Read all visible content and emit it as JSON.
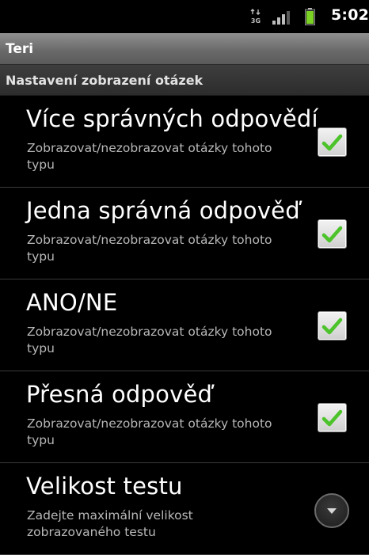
{
  "status_bar": {
    "network_type": "3G",
    "time": "5:02",
    "icons": [
      "data-3g-icon",
      "signal-strength-icon",
      "battery-icon"
    ]
  },
  "app_title": "Teri",
  "category": "Nastavení zobrazení otázek",
  "preferences": [
    {
      "title": "Více správných odpovědí",
      "summary": "Zobrazovat/nezobrazovat otázky tohoto typu",
      "checked": true
    },
    {
      "title": "Jedna správná odpověď",
      "summary": "Zobrazovat/nezobrazovat otázky tohoto typu",
      "checked": true
    },
    {
      "title": "ANO/NE",
      "summary": "Zobrazovat/nezobrazovat otázky tohoto typu",
      "checked": true
    },
    {
      "title": "Přesná odpověď",
      "summary": "Zobrazovat/nezobrazovat otázky tohoto typu",
      "checked": true
    },
    {
      "title": "Velikost testu",
      "summary": "Zadejte maximální velikost zobrazovaného testu",
      "control": "dropdown-icon"
    }
  ],
  "colors": {
    "check_green": "#4cc32a",
    "title_bar": "#7a7a7a",
    "category_bar": "#333333"
  }
}
